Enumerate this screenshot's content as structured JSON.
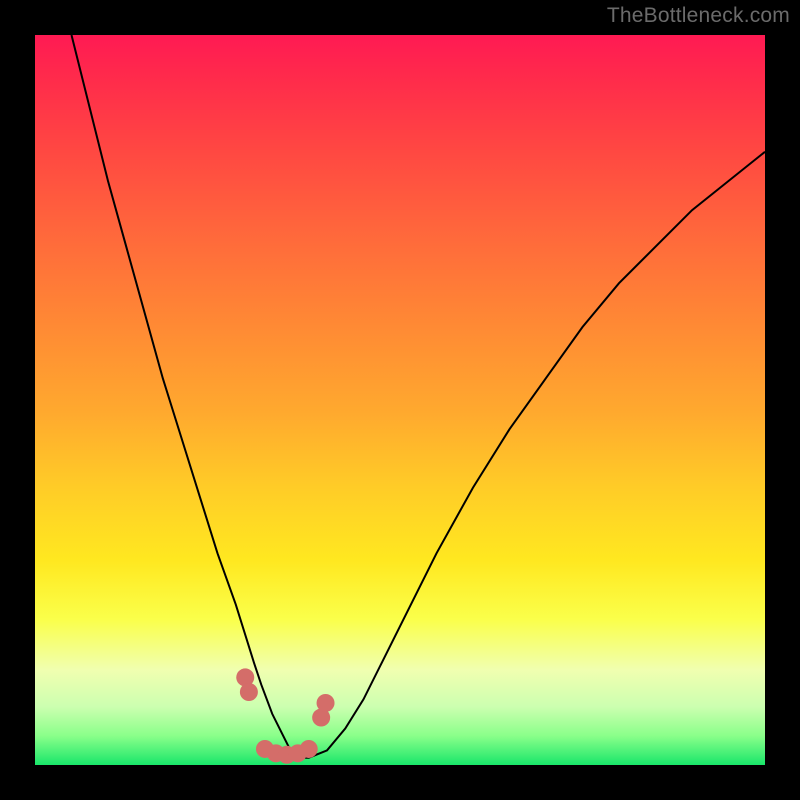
{
  "watermark": "TheBottleneck.com",
  "colors": {
    "frame": "#000000",
    "curve": "#000000",
    "marker": "#d46d69",
    "gradient_stops": [
      "#ff1a53",
      "#ff2b4b",
      "#ff4842",
      "#ff6a3b",
      "#ff8a34",
      "#ffaa2e",
      "#ffcc27",
      "#ffe820",
      "#faff4a",
      "#f0ffb0",
      "#ccffb0",
      "#8aff8a",
      "#19e66a"
    ]
  },
  "chart_data": {
    "type": "line",
    "title": "",
    "xlabel": "",
    "ylabel": "",
    "xlim": [
      0,
      100
    ],
    "ylim": [
      0,
      100
    ],
    "series": [
      {
        "name": "bottleneck-curve",
        "x": [
          5,
          7.5,
          10,
          12.5,
          15,
          17.5,
          20,
          22.5,
          25,
          27.5,
          30,
          31,
          32.5,
          34,
          35,
          36,
          37.5,
          40,
          42.5,
          45,
          47.5,
          50,
          55,
          60,
          65,
          70,
          75,
          80,
          85,
          90,
          95,
          100
        ],
        "values": [
          100,
          90,
          80,
          71,
          62,
          53,
          45,
          37,
          29,
          22,
          14,
          11,
          7,
          4,
          2,
          1,
          1,
          2,
          5,
          9,
          14,
          19,
          29,
          38,
          46,
          53,
          60,
          66,
          71,
          76,
          80,
          84
        ]
      }
    ],
    "markers": {
      "name": "highlight-dots",
      "x": [
        28.8,
        29.3,
        31.5,
        33.0,
        34.5,
        36.0,
        37.5,
        39.2,
        39.8
      ],
      "values": [
        12.0,
        10.0,
        2.2,
        1.6,
        1.4,
        1.6,
        2.2,
        6.5,
        8.5
      ],
      "radius": 9
    },
    "notch": {
      "x_norm": 0.35,
      "depth": 1.0
    }
  }
}
